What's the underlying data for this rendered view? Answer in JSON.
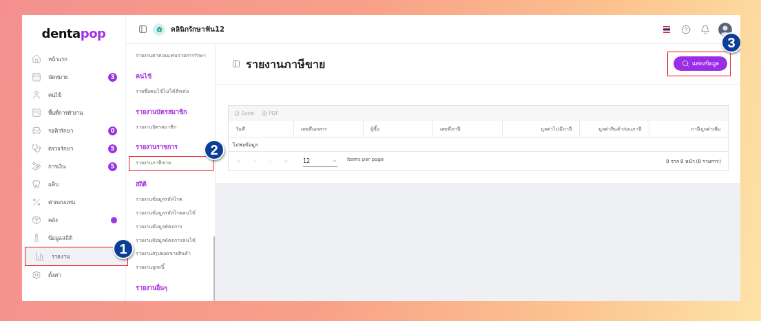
{
  "logo": {
    "first": "denta",
    "second": "pop"
  },
  "clinic_name": "คลินิกรักษาฟัน12",
  "sidebar": {
    "items": [
      {
        "label": "หน้าแรก",
        "selected": false
      },
      {
        "label": "นัดหมาย",
        "badge": "3",
        "selected": false
      },
      {
        "label": "คนไข้",
        "selected": false
      },
      {
        "label": "พื้นที่การทำงาน",
        "selected": false
      },
      {
        "label": "รอคิวรักษา",
        "badge": "0",
        "selected": false
      },
      {
        "label": "ตรวจรักษา",
        "badge": "5",
        "selected": false
      },
      {
        "label": "การเงิน",
        "badge": "5",
        "selected": false
      },
      {
        "label": "แล็บ",
        "selected": false
      },
      {
        "label": "ค่าตอบแทน",
        "selected": false
      },
      {
        "label": "คลัง",
        "dot": true,
        "selected": false
      },
      {
        "label": "ข้อมูลสถิติ",
        "selected": false
      },
      {
        "label": "รายงาน",
        "selected": true,
        "highlighted": true,
        "marker": "1"
      },
      {
        "label": "ตั้งค่า",
        "selected": false
      }
    ]
  },
  "submenu": {
    "groups": [
      {
        "items": [
          {
            "label": "รายงานค่าตอบแทนรายการรักษา"
          }
        ]
      },
      {
        "heading": "คนไข้",
        "items": [
          {
            "label": "รายชื่อคนไข้ไม่ได้ติดต่อ"
          }
        ]
      },
      {
        "heading": "รายงานบัตรสมาชิก",
        "items": [
          {
            "label": "รายงานบัตรสมาชิก"
          }
        ]
      },
      {
        "heading": "รายงานราชการ",
        "items": [
          {
            "label": "รายงานภาษีขาย",
            "highlighted": true,
            "marker": "2"
          }
        ]
      },
      {
        "heading": "สถิติ",
        "items": [
          {
            "label": "รายงานข้อมูลรหัสโรค"
          },
          {
            "label": "รายงานข้อมูลรหัสโรคคนไข้"
          },
          {
            "label": "รายงานข้อมูลหัตถการ"
          },
          {
            "label": "รายงานข้อมูลหัตถการคนไข้"
          },
          {
            "label": "รายงานสรุปยอดขายสินค้า"
          },
          {
            "label": "รายงานลูกหนี้"
          }
        ]
      },
      {
        "heading": "รายงานอื่นๆ"
      }
    ]
  },
  "page": {
    "title": "รายงานภาษีขาย",
    "show_button": {
      "label": "แสดงข้อมูล",
      "highlighted": true,
      "marker": "3"
    }
  },
  "table": {
    "exports": [
      {
        "label": "Excel",
        "disabled": true
      },
      {
        "label": "PDF",
        "disabled": true
      }
    ],
    "columns": [
      "วันที่",
      "เลขที่เอกสาร",
      "ผู้ซื้อ",
      "เลขที่ภาษี",
      "มูลค่าไม่มีภาษี",
      "มูลค่าสินค้าก่อนภาษี",
      "ภาษีมูลค่าเพิ่ม"
    ],
    "empty_message": "ไม่พบข้อมูล",
    "pagination": {
      "page_size": "12",
      "per_page_label": "Items per page",
      "summary": "0 จาก 0 หน้า (0 รายการ)"
    }
  }
}
